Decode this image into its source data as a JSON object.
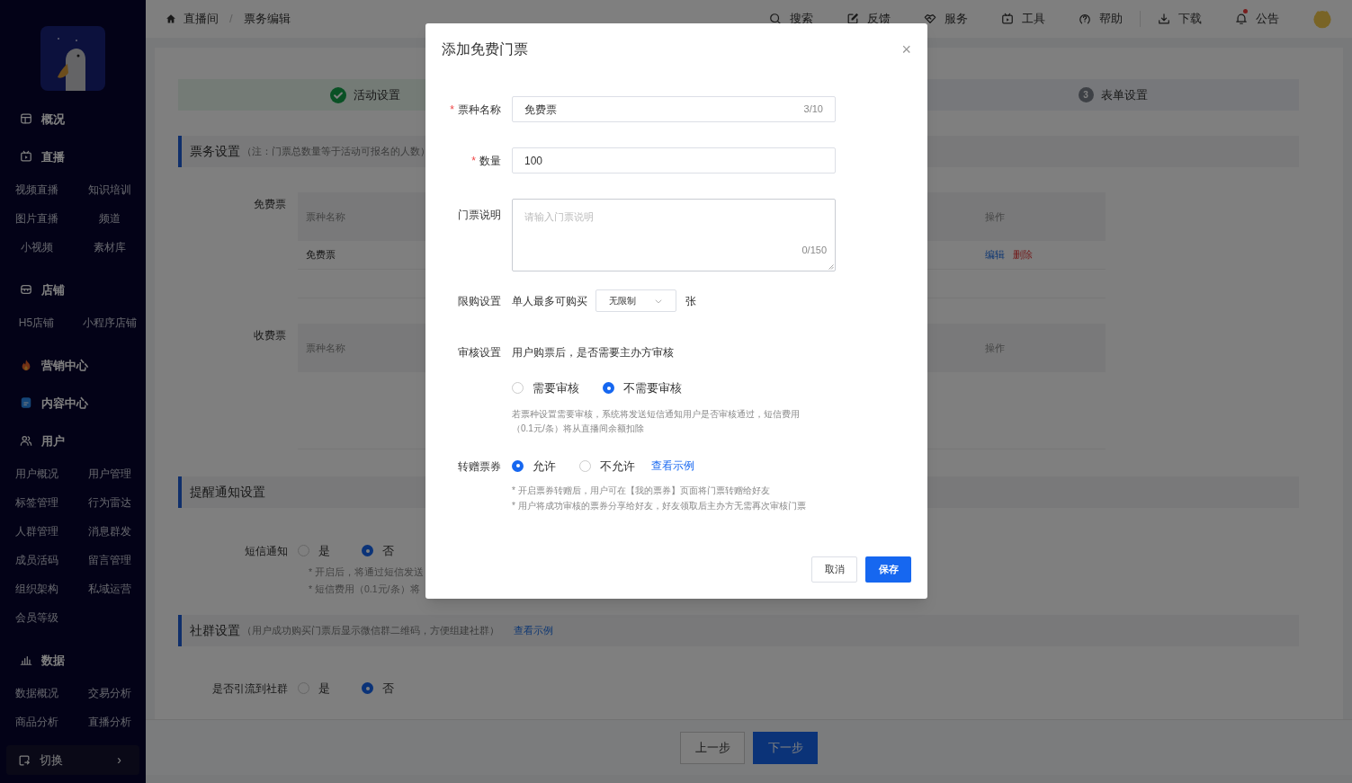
{
  "sidebar": {
    "nav": [
      {
        "label": "概况"
      },
      {
        "label": "直播",
        "children": [
          "视频直播",
          "知识培训",
          "图片直播",
          "频道",
          "小视频",
          "素材库"
        ]
      },
      {
        "label": "店铺",
        "children": [
          "H5店铺",
          "小程序店铺"
        ]
      },
      {
        "label": "营销中心"
      },
      {
        "label": "内容中心"
      },
      {
        "label": "用户",
        "children": [
          "用户概况",
          "用户管理",
          "标签管理",
          "行为雷达",
          "人群管理",
          "消息群发",
          "成员活码",
          "留言管理",
          "组织架构",
          "私域运营",
          "会员等级"
        ]
      },
      {
        "label": "数据",
        "children": [
          "数据概况",
          "交易分析",
          "商品分析",
          "直播分析"
        ]
      }
    ],
    "switch_button": {
      "label": "切换",
      "arrow": "›"
    }
  },
  "breadcrumb": {
    "items": [
      "直播间",
      "票务编辑"
    ],
    "separator": "/"
  },
  "toolbar": [
    {
      "label": "搜索",
      "dot": false
    },
    {
      "label": "反馈",
      "dot": false
    },
    {
      "label": "服务",
      "dot": false
    },
    {
      "label": "工具",
      "dot": false
    },
    {
      "label": "帮助",
      "dot": false
    },
    {
      "label": "下载",
      "dot": false
    },
    {
      "label": "公告",
      "dot": true
    }
  ],
  "steps": [
    {
      "label": "活动设置",
      "done": true
    },
    {
      "number": "3",
      "label": "表单设置",
      "done": false
    }
  ],
  "ticket_settings": {
    "title": "票务设置",
    "note": "（注：门票总数量等于活动可报名的人数）",
    "groups": [
      {
        "label": "免费票",
        "columns": [
          "票种名称",
          "操作"
        ],
        "rows": [
          {
            "name": "免费票",
            "actions": [
              {
                "label": "编辑",
                "kind": "edit"
              },
              {
                "label": "删除",
                "kind": "delete"
              }
            ]
          }
        ]
      },
      {
        "label": "收费票",
        "columns": [
          "票种名称",
          "操作"
        ]
      }
    ]
  },
  "reminder": {
    "title": "提醒通知设置",
    "label": "短信通知",
    "options": [
      {
        "label": "是",
        "selected": false
      },
      {
        "label": "否",
        "selected": true
      }
    ],
    "notes": [
      "* 开启后，将通过短信发送",
      "* 短信费用（0.1元/条）将"
    ]
  },
  "community": {
    "title": "社群设置",
    "note": "（用户成功购买门票后显示微信群二维码，方便组建社群）",
    "link": "查看示例",
    "label": "是否引流到社群",
    "options": [
      {
        "label": "是",
        "selected": false
      },
      {
        "label": "否",
        "selected": true
      }
    ]
  },
  "footer_buttons": [
    {
      "label": "上一步",
      "kind": "secondary"
    },
    {
      "label": "下一步",
      "kind": "primary"
    }
  ],
  "dialog": {
    "title": "添加免费门票",
    "close": "×",
    "fields": [
      {
        "kind": "input",
        "label": "票种名称",
        "required_mark": "*",
        "value": "免费票",
        "counter": "3/10"
      },
      {
        "kind": "input",
        "label": "数量",
        "required_mark": "*",
        "value": "100"
      },
      {
        "kind": "textarea",
        "label": "门票说明",
        "placeholder": "请输入门票说明",
        "counter": "0/150"
      },
      {
        "kind": "limit",
        "label": "限购设置",
        "prefix": "单人最多可购买",
        "select": "无限制",
        "suffix": "张"
      },
      {
        "kind": "review",
        "label": "审核设置",
        "question": "用户购票后，是否需要主办方审核",
        "options": [
          {
            "label": "需要审核",
            "selected": false
          },
          {
            "label": "不需要审核",
            "selected": true
          }
        ],
        "hint": "若票种设置需要审核，系统将发送短信通知用户是否审核通过，短信费用（0.1元/条）将从直播间余额扣除"
      },
      {
        "kind": "transfer",
        "label": "转赠票券",
        "options": [
          {
            "label": "允许",
            "selected": true
          },
          {
            "label": "不允许",
            "selected": false
          }
        ],
        "link": "查看示例",
        "notes": [
          "* 开启票券转赠后，用户可在【我的票券】页面将门票转赠给好友",
          "* 用户将成功审核的票券分享给好友，好友领取后主办方无需再次审核门票"
        ]
      }
    ],
    "buttons": [
      {
        "label": "取消",
        "kind": "secondary"
      },
      {
        "label": "保存",
        "kind": "primary"
      }
    ]
  }
}
